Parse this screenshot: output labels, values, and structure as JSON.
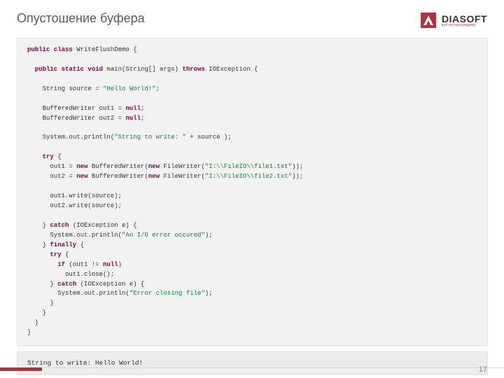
{
  "title": "Опустошение буфера",
  "logo": {
    "name": "DIASOFT",
    "tagline": "всё по-настоящему"
  },
  "code": {
    "l1a": "public class",
    "l1b": " WriteFlushDemo {",
    "l2a": "  public static void",
    "l2b": " main(String[] args) ",
    "l2c": "throws",
    "l2d": " IOException {",
    "l3a": "    String source = ",
    "l3b": "\"Hello World!\"",
    "l3c": ";",
    "l4a": "    BufferedWriter out1 = ",
    "l4b": "null",
    "l4c": ";",
    "l5a": "    BufferedWriter out2 = ",
    "l5b": "null",
    "l5c": ";",
    "l6a": "    System.",
    "l6b": "out",
    "l6c": ".println(",
    "l6d": "\"String to write: \"",
    "l6e": " + source );",
    "l7a": "    try",
    "l7b": " {",
    "l8a": "      out1 = ",
    "l8b": "new",
    "l8c": " BufferedWriter(",
    "l8d": "new",
    "l8e": " FileWriter(",
    "l8f": "\"I:\\\\FileIO\\\\file1.txt\"",
    "l8g": "));",
    "l9a": "      out2 = ",
    "l9b": "new",
    "l9c": " BufferedWriter(",
    "l9d": "new",
    "l9e": " FileWriter(",
    "l9f": "\"I:\\\\FileIO\\\\file2.txt\"",
    "l9g": "));",
    "l10": "      out1.write(source);",
    "l11": "      out2.write(source);",
    "l12a": "    } ",
    "l12b": "catch",
    "l12c": " (IOException e) {",
    "l13a": "      System.",
    "l13b": "out",
    "l13c": ".println(",
    "l13d": "\"An I/O error occured\"",
    "l13e": ");",
    "l14a": "    } ",
    "l14b": "finally",
    "l14c": " {",
    "l15a": "      try",
    "l15b": " {",
    "l16a": "        if",
    "l16b": " (out1 != ",
    "l16c": "null",
    "l16d": ")",
    "l17": "          out1.close();",
    "l18a": "      } ",
    "l18b": "catch",
    "l18c": " (IOException e) {",
    "l19a": "        System.",
    "l19b": "out",
    "l19c": ".println(",
    "l19d": "\"Error closing file\"",
    "l19e": ");",
    "l20": "      }",
    "l21": "    }",
    "l22": "  }",
    "l23": "}"
  },
  "output": "String to write: Hello World!",
  "page": "17"
}
